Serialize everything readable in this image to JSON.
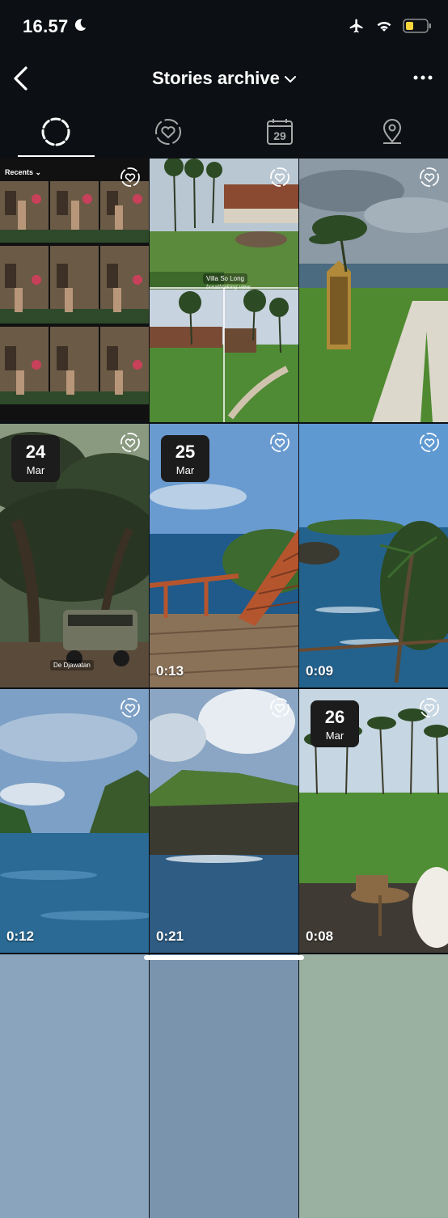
{
  "status": {
    "time": "16.57"
  },
  "header": {
    "title": "Stories archive"
  },
  "tabs": [
    {
      "name": "stories-tab",
      "icon": "story-ring-icon",
      "active": true
    },
    {
      "name": "highlights-tab",
      "icon": "heart-circle-icon"
    },
    {
      "name": "calendar-tab",
      "icon": "calendar-icon",
      "label": "29"
    },
    {
      "name": "map-tab",
      "icon": "location-pin-icon"
    }
  ],
  "grid": [
    {
      "recents": "Recents ⌄"
    },
    {
      "location": "Villa So Long",
      "caption": "breathtaking view"
    },
    {},
    {
      "date_day": "24",
      "date_month": "Mar",
      "location": "De Djawatan"
    },
    {
      "date_day": "25",
      "date_month": "Mar",
      "duration": "0:13"
    },
    {
      "duration": "0:09"
    },
    {
      "duration": "0:12"
    },
    {
      "duration": "0:21"
    },
    {
      "date_day": "26",
      "date_month": "Mar",
      "duration": "0:08"
    }
  ]
}
